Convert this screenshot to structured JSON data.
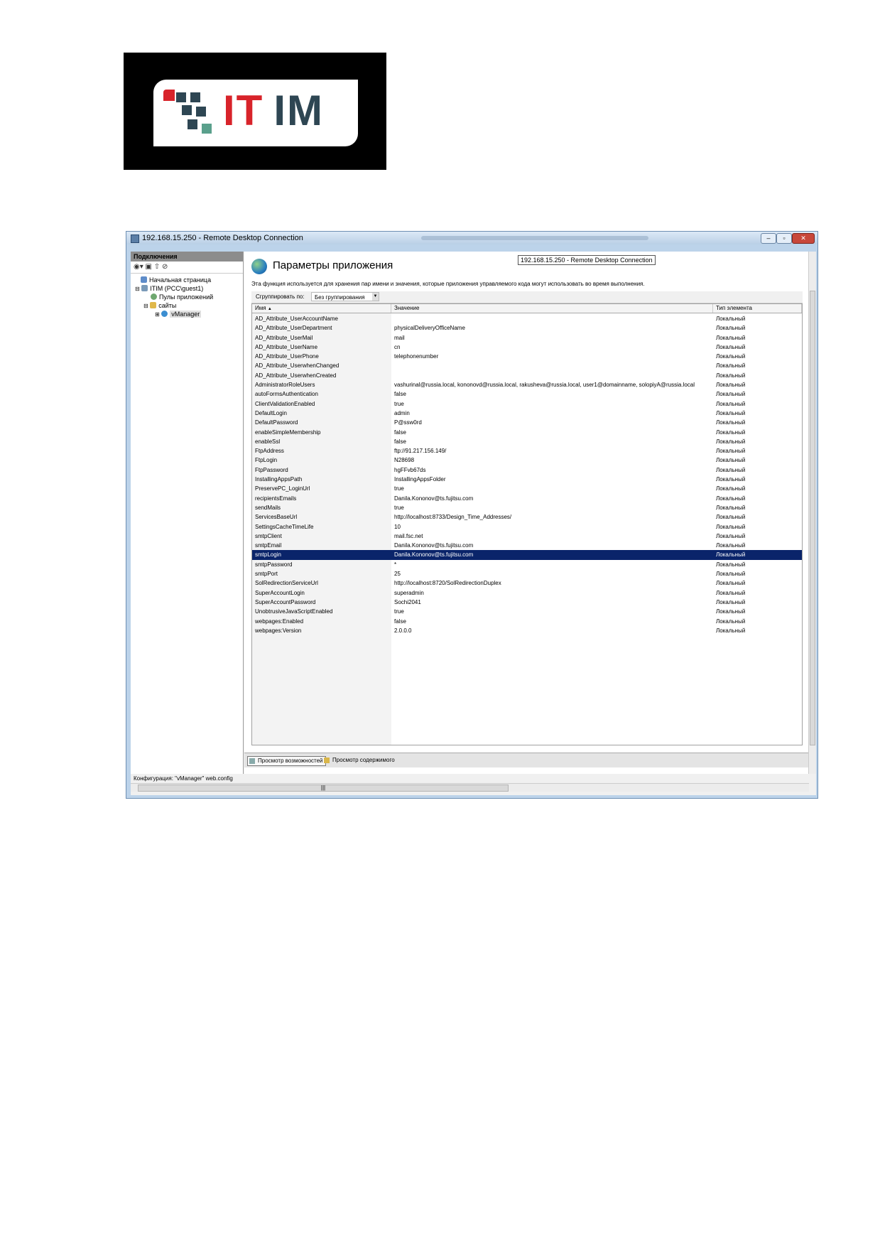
{
  "logo": {
    "text_it": "IT",
    "text_im": "IM"
  },
  "window": {
    "title": "192.168.15.250 - Remote Desktop Connection",
    "tooltip": "192.168.15.250 - Remote Desktop Connection"
  },
  "left_pane": {
    "header": "Подключения",
    "tree": [
      {
        "label": "Начальная страница"
      },
      {
        "label": "ITIM (PCC\\guest1)"
      },
      {
        "label": "Пулы приложений"
      },
      {
        "label": "сайты"
      },
      {
        "label": "vManager"
      }
    ]
  },
  "main": {
    "title": "Параметры приложения",
    "description": "Эта функция используется для хранения пар имени и значения, которые приложения управляемого кода могут использовать во время выполнения.",
    "group_label": "Сгруппировать по:",
    "group_value": "Без группирования",
    "columns": {
      "name": "Имя",
      "value": "Значение",
      "type": "Тип элемента"
    },
    "rows": [
      {
        "name": "AD_Attribute_UserAccountName",
        "value": "",
        "type": "Локальный"
      },
      {
        "name": "AD_Attribute_UserDepartment",
        "value": "physicalDeliveryOfficeName",
        "type": "Локальный"
      },
      {
        "name": "AD_Attribute_UserMail",
        "value": "mail",
        "type": "Локальный"
      },
      {
        "name": "AD_Attribute_UserName",
        "value": "cn",
        "type": "Локальный"
      },
      {
        "name": "AD_Attribute_UserPhone",
        "value": "telephonenumber",
        "type": "Локальный"
      },
      {
        "name": "AD_Attribute_UserwhenChanged",
        "value": "",
        "type": "Локальный"
      },
      {
        "name": "AD_Attribute_UserwhenCreated",
        "value": "",
        "type": "Локальный"
      },
      {
        "name": "AdministratorRoleUsers",
        "value": "vashurinal@russia.local, kononovd@russia.local, rakusheva@russia.local, user1@domainname, solopiyA@russia.local",
        "type": "Локальный"
      },
      {
        "name": "autoFormsAuthentication",
        "value": "false",
        "type": "Локальный"
      },
      {
        "name": "ClientValidationEnabled",
        "value": "true",
        "type": "Локальный"
      },
      {
        "name": "DefaultLogin",
        "value": "admin",
        "type": "Локальный"
      },
      {
        "name": "DefaultPassword",
        "value": "P@ssw0rd",
        "type": "Локальный"
      },
      {
        "name": "enableSimpleMembership",
        "value": "false",
        "type": "Локальный"
      },
      {
        "name": "enableSsl",
        "value": "false",
        "type": "Локальный"
      },
      {
        "name": "FtpAddress",
        "value": "ftp://91.217.156.149/",
        "type": "Локальный"
      },
      {
        "name": "FtpLogin",
        "value": "N28698",
        "type": "Локальный"
      },
      {
        "name": "FtpPassword",
        "value": "hgFFvb67ds",
        "type": "Локальный"
      },
      {
        "name": "InstallingAppsPath",
        "value": "InstallingAppsFolder",
        "type": "Локальный"
      },
      {
        "name": "PreservePC_LoginUrl",
        "value": "true",
        "type": "Локальный"
      },
      {
        "name": "recipientsEmails",
        "value": "Danila.Kononov@ts.fujitsu.com",
        "type": "Локальный"
      },
      {
        "name": "sendMails",
        "value": "true",
        "type": "Локальный"
      },
      {
        "name": "ServicesBaseUrl",
        "value": "http://localhost:8733/Design_Time_Addresses/",
        "type": "Локальный"
      },
      {
        "name": "SettingsCacheTimeLife",
        "value": "10",
        "type": "Локальный"
      },
      {
        "name": "smtpClient",
        "value": "mail.fsc.net",
        "type": "Локальный"
      },
      {
        "name": "smtpEmail",
        "value": "Danila.Kononov@ts.fujitsu.com",
        "type": "Локальный"
      },
      {
        "name": "smtpLogin",
        "value": "Danila.Kononov@ts.fujitsu.com",
        "type": "Локальный",
        "selected": true
      },
      {
        "name": "smtpPassword",
        "value": "*",
        "type": "Локальный"
      },
      {
        "name": "smtpPort",
        "value": "25",
        "type": "Локальный"
      },
      {
        "name": "SolRedirectionServiceUrl",
        "value": "http://localhost:8720/SolRedirectionDuplex",
        "type": "Локальный"
      },
      {
        "name": "SuperAccountLogin",
        "value": "superadmin",
        "type": "Локальный"
      },
      {
        "name": "SuperAccountPassword",
        "value": "Sochi2041",
        "type": "Локальный"
      },
      {
        "name": "UnobtrusiveJavaScriptEnabled",
        "value": "true",
        "type": "Локальный"
      },
      {
        "name": "webpages:Enabled",
        "value": "false",
        "type": "Локальный"
      },
      {
        "name": "webpages:Version",
        "value": "2.0.0.0",
        "type": "Локальный"
      }
    ],
    "tabs": {
      "features": "Просмотр возможностей",
      "content": "Просмотр содержимого"
    }
  },
  "status_text": "Конфигурация: \"vManager\" web.config",
  "colors": {
    "logo_red": "#d8232a",
    "logo_dark": "#2e4653",
    "selection": "#0a246a"
  }
}
